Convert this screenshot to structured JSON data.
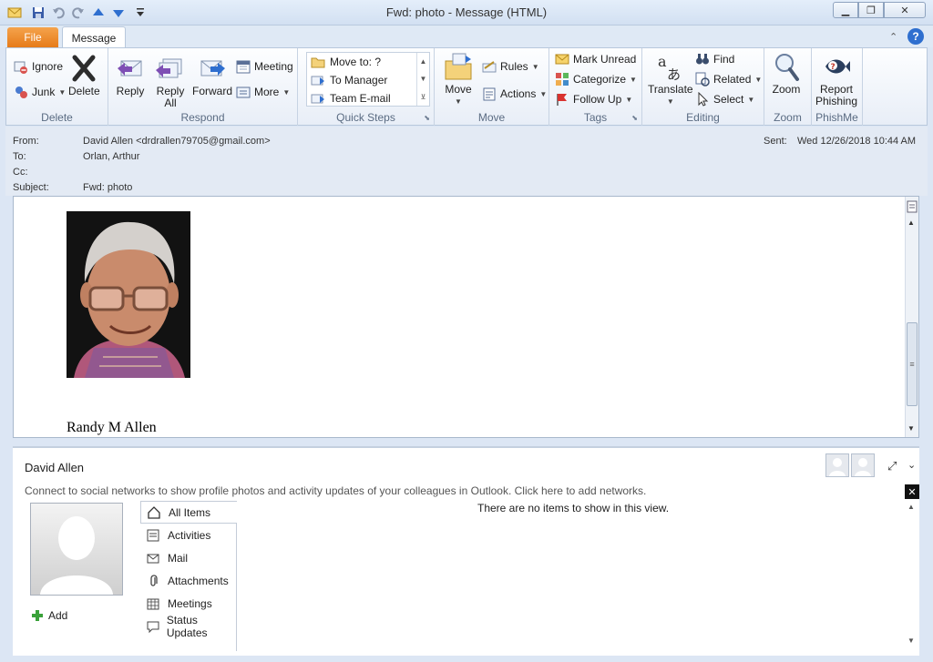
{
  "window": {
    "title": "Fwd: photo  -  Message (HTML)"
  },
  "tabs": {
    "file": "File",
    "message": "Message"
  },
  "ribbon": {
    "delete": {
      "ignore": "Ignore",
      "junk": "Junk",
      "delete": "Delete",
      "label": "Delete"
    },
    "respond": {
      "reply": "Reply",
      "reply_all_1": "Reply",
      "reply_all_2": "All",
      "forward": "Forward",
      "meeting": "Meeting",
      "more": "More",
      "label": "Respond"
    },
    "quick_steps": {
      "items": [
        "Move to: ?",
        "To Manager",
        "Team E-mail"
      ],
      "label": "Quick Steps"
    },
    "move": {
      "move": "Move",
      "rules": "Rules",
      "actions": "Actions",
      "label": "Move"
    },
    "tags": {
      "mark_unread": "Mark Unread",
      "categorize": "Categorize",
      "follow_up": "Follow Up",
      "label": "Tags"
    },
    "editing": {
      "translate": "Translate",
      "find": "Find",
      "related": "Related",
      "select": "Select",
      "label": "Editing"
    },
    "zoom": {
      "zoom": "Zoom",
      "label": "Zoom"
    },
    "phishme": {
      "report_1": "Report",
      "report_2": "Phishing",
      "label": "PhishMe"
    }
  },
  "header": {
    "from_label": "From:",
    "from": "David Allen <drdrallen79705@gmail.com>",
    "to_label": "To:",
    "to": "Orlan, Arthur",
    "cc_label": "Cc:",
    "cc": "",
    "subject_label": "Subject:",
    "subject": "Fwd: photo",
    "sent_label": "Sent:",
    "sent": "Wed 12/26/2018 10:44 AM"
  },
  "body": {
    "signature": "Randy M Allen"
  },
  "people_pane": {
    "name": "David Allen",
    "connect_msg": "Connect to social networks to show profile photos and activity updates of your colleagues in Outlook. Click here to add networks.",
    "add": "Add",
    "nav": [
      "All Items",
      "Activities",
      "Mail",
      "Attachments",
      "Meetings",
      "Status Updates"
    ],
    "empty": "There are no items to show in this view."
  }
}
